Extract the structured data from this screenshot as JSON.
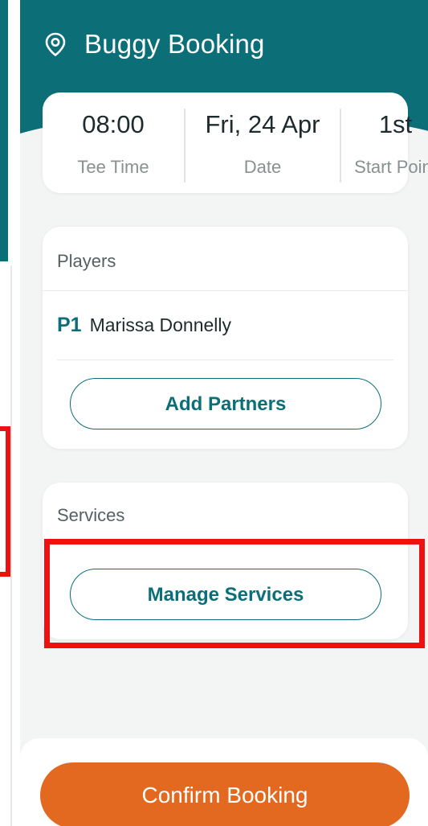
{
  "header": {
    "title": "Buggy Booking",
    "icon": "location-pin-icon"
  },
  "booking_info": {
    "tee_time": {
      "value": "08:00",
      "label": "Tee Time"
    },
    "date": {
      "value": "Fri, 24 Apr",
      "label": "Date"
    },
    "start_point": {
      "value": "1st",
      "label": "Start Point"
    }
  },
  "players": {
    "title": "Players",
    "items": [
      {
        "tag": "P1",
        "name": "Marissa Donnelly"
      }
    ],
    "add_partners_label": "Add Partners"
  },
  "services": {
    "title": "Services",
    "manage_label": "Manage Services"
  },
  "footer": {
    "confirm_label": "Confirm Booking"
  },
  "colors": {
    "brand_teal": "#0c6f78",
    "confirm_orange": "#e2691f",
    "highlight_red": "#ee1111",
    "background": "#f3f4f4"
  }
}
